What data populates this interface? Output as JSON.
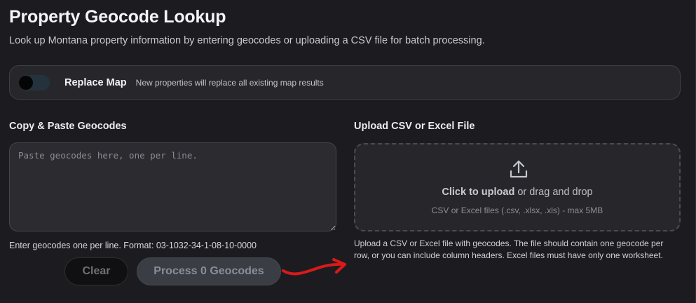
{
  "header": {
    "title": "Property Geocode Lookup",
    "subtitle": "Look up Montana property information by entering geocodes or uploading a CSV file for batch processing."
  },
  "replace_map": {
    "label": "Replace Map",
    "hint": "New properties will replace all existing map results",
    "enabled": false
  },
  "paste_section": {
    "label": "Copy & Paste Geocodes",
    "placeholder": "Paste geocodes here, one per line.",
    "value": "",
    "helper": "Enter geocodes one per line. Format: 03-1032-34-1-08-10-0000",
    "clear_label": "Clear",
    "process_label": "Process 0 Geocodes"
  },
  "upload_section": {
    "label": "Upload CSV or Excel File",
    "click_text": "Click to upload",
    "drag_text": " or drag and drop",
    "file_types": "CSV or Excel files (.csv, .xlsx, .xls) - max 5MB",
    "helper": "Upload a CSV or Excel file with geocodes. The file should contain one geocode per row, or you can include column headers. Excel files must have only one worksheet."
  },
  "annotation": {
    "icon": "red-arrow-icon",
    "color": "#d91a1a"
  },
  "colors": {
    "background": "#1c1c20",
    "panel": "#27272b",
    "toggle_track": "#24323e",
    "button_disabled": "#3a3d44"
  }
}
